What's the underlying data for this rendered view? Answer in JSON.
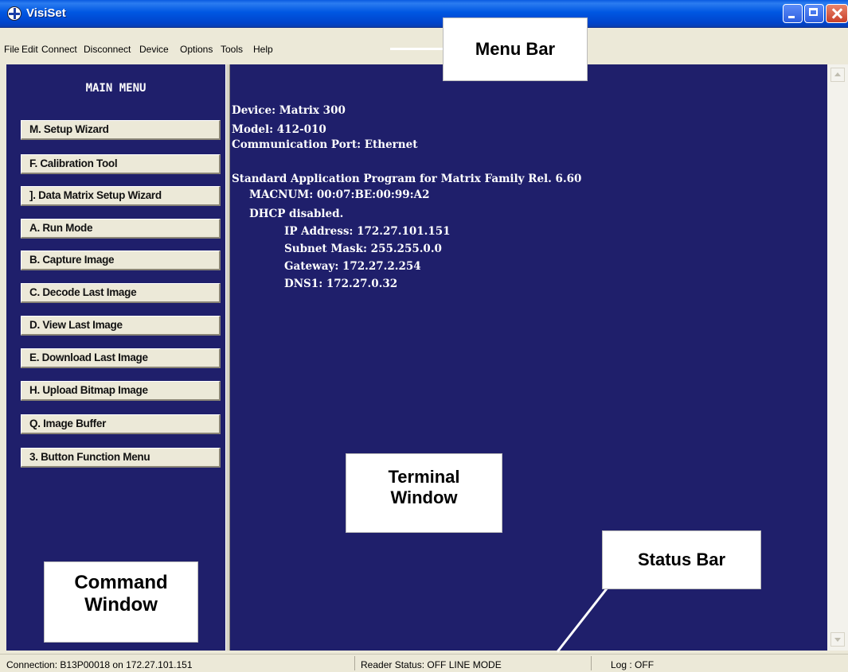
{
  "window": {
    "title": "VisiSet"
  },
  "menubar": {
    "items": [
      "File",
      "Edit",
      "Connect",
      "Disconnect",
      "Device",
      "Options",
      "Tools",
      "Help"
    ]
  },
  "command_panel": {
    "title": "MAIN MENU",
    "buttons": [
      "M. Setup Wizard",
      "F. Calibration Tool",
      "]. Data Matrix Setup Wizard",
      "A. Run Mode",
      "B. Capture Image",
      "C. Decode Last Image",
      "D. View Last Image",
      "E. Download Last Image",
      "H. Upload Bitmap Image",
      "Q. Image Buffer",
      "3. Button Function Menu"
    ]
  },
  "terminal": {
    "lines": [
      "Device: Matrix 300",
      "Model: 412-010",
      "Communication Port: Ethernet",
      "Standard Application Program for Matrix Family Rel. 6.60",
      "MACNUM: 00:07:BE:00:99:A2",
      "DHCP disabled.",
      "IP Address: 172.27.101.151",
      "Subnet Mask: 255.255.0.0",
      "Gateway: 172.27.2.254",
      "DNS1: 172.27.0.32"
    ]
  },
  "statusbar": {
    "connection": "Connection: B13P00018 on 172.27.101.151",
    "reader_status": "Reader Status: OFF LINE MODE",
    "log": "Log : OFF"
  },
  "callouts": {
    "menu_bar": "Menu Bar",
    "terminal_window": [
      "Terminal",
      "Window"
    ],
    "status_bar": "Status Bar",
    "command_window": [
      "Command",
      "Window"
    ]
  },
  "colors": {
    "panel_bg": "#1f1f6b",
    "title_bar": "#0054e3",
    "chrome": "#ece9d8"
  }
}
